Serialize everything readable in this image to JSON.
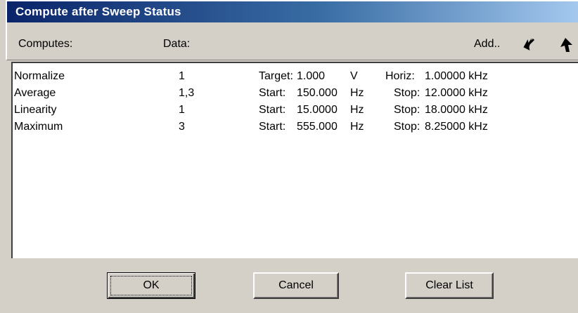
{
  "window": {
    "title": "Compute after Sweep Status"
  },
  "toolbar": {
    "computes_label": "Computes:",
    "data_label": "Data:",
    "add_label": "Add..",
    "move_down_icon": "arrow-down-icon",
    "move_up_icon": "arrow-up-icon"
  },
  "rows": [
    {
      "name": "Normalize",
      "data": "1",
      "label1": "Target:",
      "value1": "1.000",
      "unit1": "V",
      "label2": "Horiz:",
      "value2": "1.00000 kHz"
    },
    {
      "name": "Average",
      "data": "1,3",
      "label1": "Start:",
      "value1": "150.000",
      "unit1": "Hz",
      "label2": "Stop:",
      "value2": "12.0000 kHz"
    },
    {
      "name": "Linearity",
      "data": "1",
      "label1": "Start:",
      "value1": "15.0000",
      "unit1": "Hz",
      "label2": "Stop:",
      "value2": "18.0000 kHz"
    },
    {
      "name": "Maximum",
      "data": "3",
      "label1": "Start:",
      "value1": "555.000",
      "unit1": "Hz",
      "label2": "Stop:",
      "value2": "8.25000 kHz"
    }
  ],
  "buttons": {
    "ok": "OK",
    "cancel": "Cancel",
    "clear": "Clear List"
  }
}
